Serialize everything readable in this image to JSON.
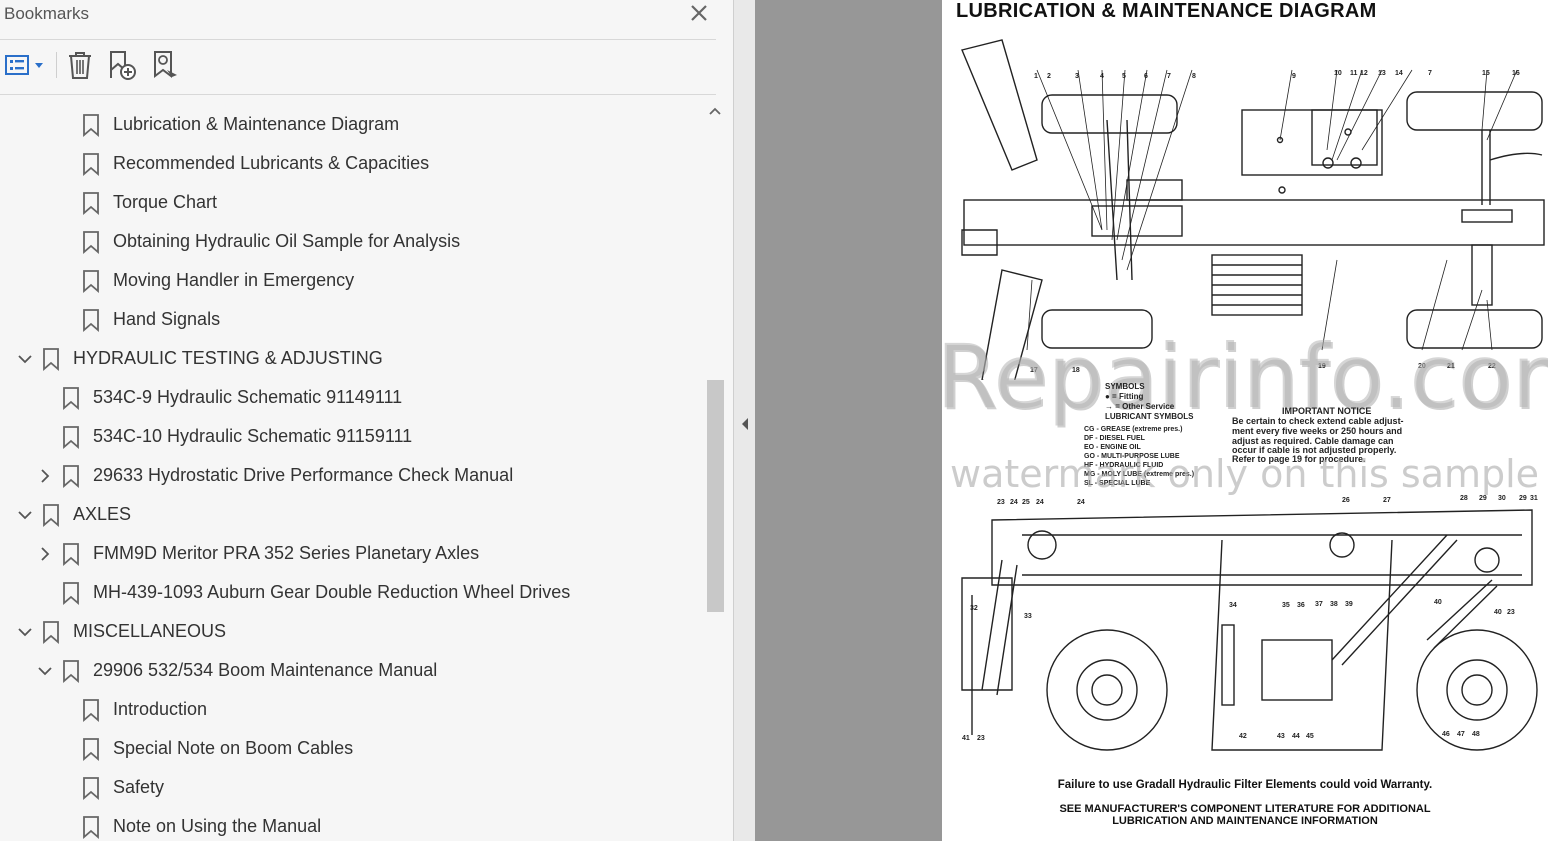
{
  "panel": {
    "title": "Bookmarks",
    "close_icon": "close-icon",
    "toolbar": [
      {
        "icon": "options-list-icon",
        "name": "bookmark-options-menu"
      },
      {
        "icon": "trash-icon",
        "name": "delete-bookmark-button"
      },
      {
        "icon": "add-bookmark-icon",
        "name": "new-bookmark-button"
      },
      {
        "icon": "bookmark-search-icon",
        "name": "expand-current-bookmark-button"
      }
    ]
  },
  "bookmarks": [
    {
      "label": "Lubrication & Maintenance Diagram",
      "level": 2,
      "chevron": "none"
    },
    {
      "label": "Recommended Lubricants & Capacities",
      "level": 2,
      "chevron": "none"
    },
    {
      "label": "Torque Chart",
      "level": 2,
      "chevron": "none"
    },
    {
      "label": "Obtaining Hydraulic Oil Sample for Analysis",
      "level": 2,
      "chevron": "none"
    },
    {
      "label": "Moving Handler in Emergency",
      "level": 2,
      "chevron": "none"
    },
    {
      "label": "Hand Signals",
      "level": 2,
      "chevron": "none"
    },
    {
      "label": "HYDRAULIC TESTING & ADJUSTING",
      "level": 0,
      "chevron": "down"
    },
    {
      "label": "534C-9 Hydraulic Schematic 91149111",
      "level": 1,
      "chevron": "none"
    },
    {
      "label": "534C-10 Hydraulic Schematic 91159111",
      "level": 1,
      "chevron": "none"
    },
    {
      "label": "29633 Hydrostatic Drive Performance Check Manual",
      "level": 1,
      "chevron": "right"
    },
    {
      "label": "AXLES",
      "level": 0,
      "chevron": "down"
    },
    {
      "label": "FMM9D Meritor PRA 352 Series Planetary Axles",
      "level": 1,
      "chevron": "right"
    },
    {
      "label": "MH-439-1093 Auburn Gear Double Reduction Wheel Drives",
      "level": 1,
      "chevron": "none"
    },
    {
      "label": "MISCELLANEOUS",
      "level": 0,
      "chevron": "down"
    },
    {
      "label": "29906 532/534 Boom Maintenance Manual",
      "level": 1,
      "chevron": "down"
    },
    {
      "label": "Introduction",
      "level": 2,
      "chevron": "none"
    },
    {
      "label": "Special Note on Boom Cables",
      "level": 2,
      "chevron": "none"
    },
    {
      "label": "Safety",
      "level": 2,
      "chevron": "none"
    },
    {
      "label": "Note on Using the Manual",
      "level": 2,
      "chevron": "none"
    }
  ],
  "document": {
    "title": "LUBRICATION & MAINTENANCE DIAGRAM",
    "symbols_heading": "SYMBOLS",
    "symbols": [
      "● = Fitting",
      "→ = Other Service"
    ],
    "lubricant_heading": "LUBRICANT SYMBOLS",
    "lubricants": [
      "CG - GREASE (extreme pres.)",
      "DF - DIESEL FUEL",
      "EO - ENGINE OIL",
      "GO - MULTI-PURPOSE LUBE",
      "HF - HYDRAULIC FLUID",
      "MG - MOLY LUBE (extreme pres.)",
      "SL - SPECIAL LUBE"
    ],
    "notice_heading": "IMPORTANT NOTICE",
    "notice_lines": [
      "Be certain to check extend cable adjust-",
      "ment every five weeks or 250 hours and",
      "adjust as required. Cable damage can",
      "occur if cable is not adjusted properly.",
      "Refer to page 19 for procedure."
    ],
    "warranty": "Failure to use Gradall Hydraulic Filter Elements could void Warranty.",
    "footer_lines": [
      "SEE MANUFACTURER'S COMPONENT LITERATURE FOR ADDITIONAL",
      "LUBRICATION AND MAINTENANCE INFORMATION"
    ],
    "watermark_main": "eRepairinfo.com",
    "watermark_sub": "watermark only on this sample"
  },
  "colors": {
    "panel_bg": "#f6f6f6",
    "gutter_gray": "#979797",
    "text": "#333333",
    "icon_blue": "#2a6fc9"
  }
}
